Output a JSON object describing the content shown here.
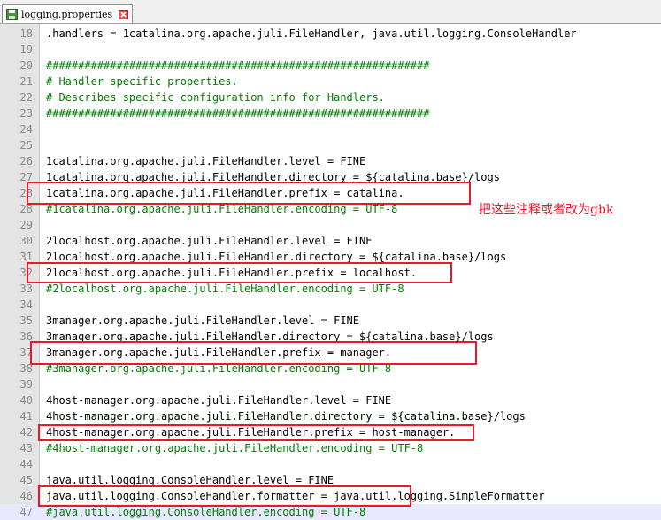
{
  "tab": {
    "label": "logging.properties",
    "icon": "save-icon",
    "close_icon": "close-icon"
  },
  "colors": {
    "comment": "#008000",
    "highlight": "#e81a2a",
    "line_number": "#8a8a8a"
  },
  "annotation": "把这些注释或者改为gbk",
  "lines": [
    {
      "num": "18",
      "text": ".handlers = 1catalina.org.apache.juli.FileHandler, java.util.logging.ConsoleHandler",
      "comment": false
    },
    {
      "num": "19",
      "text": "",
      "comment": false
    },
    {
      "num": "20",
      "text": "############################################################",
      "comment": true
    },
    {
      "num": "21",
      "text": "# Handler specific properties.",
      "comment": true
    },
    {
      "num": "22",
      "text": "# Describes specific configuration info for Handlers.",
      "comment": true
    },
    {
      "num": "23",
      "text": "############################################################",
      "comment": true
    },
    {
      "num": "24",
      "text": "",
      "comment": false
    },
    {
      "num": "25",
      "text": "",
      "comment": false
    },
    {
      "num": "26",
      "text": "1catalina.org.apache.juli.FileHandler.level = FINE",
      "comment": false
    },
    {
      "num": "27",
      "text": "1catalina.org.apache.juli.FileHandler.directory = ${catalina.base}/logs",
      "comment": false
    },
    {
      "num": "28",
      "text": "1catalina.org.apache.juli.FileHandler.prefix = catalina.",
      "comment": false
    },
    {
      "num": "28",
      "text": "#1catalina.org.apache.juli.FileHandler.encoding = UTF-8",
      "comment": true
    },
    {
      "num": "29",
      "text": "",
      "comment": false
    },
    {
      "num": "30",
      "text": "2localhost.org.apache.juli.FileHandler.level = FINE",
      "comment": false
    },
    {
      "num": "31",
      "text": "2localhost.org.apache.juli.FileHandler.directory = ${catalina.base}/logs",
      "comment": false
    },
    {
      "num": "32",
      "text": "2localhost.org.apache.juli.FileHandler.prefix = localhost.",
      "comment": false
    },
    {
      "num": "33",
      "text": "#2localhost.org.apache.juli.FileHandler.encoding = UTF-8",
      "comment": true
    },
    {
      "num": "34",
      "text": "",
      "comment": false
    },
    {
      "num": "35",
      "text": "3manager.org.apache.juli.FileHandler.level = FINE",
      "comment": false
    },
    {
      "num": "36",
      "text": "3manager.org.apache.juli.FileHandler.directory = ${catalina.base}/logs",
      "comment": false
    },
    {
      "num": "37",
      "text": "3manager.org.apache.juli.FileHandler.prefix = manager.",
      "comment": false
    },
    {
      "num": "38",
      "text": "#3manager.org.apache.juli.FileHandler.encoding = UTF-8",
      "comment": true
    },
    {
      "num": "39",
      "text": "",
      "comment": false
    },
    {
      "num": "40",
      "text": "4host-manager.org.apache.juli.FileHandler.level = FINE",
      "comment": false
    },
    {
      "num": "41",
      "text": "4host-manager.org.apache.juli.FileHandler.directory = ${catalina.base}/logs",
      "comment": false
    },
    {
      "num": "42",
      "text": "4host-manager.org.apache.juli.FileHandler.prefix = host-manager.",
      "comment": false
    },
    {
      "num": "43",
      "text": "#4host-manager.org.apache.juli.FileHandler.encoding = UTF-8",
      "comment": true
    },
    {
      "num": "44",
      "text": "",
      "comment": false
    },
    {
      "num": "45",
      "text": "java.util.logging.ConsoleHandler.level = FINE",
      "comment": false
    },
    {
      "num": "46",
      "text": "java.util.logging.ConsoleHandler.formatter = java.util.logging.SimpleFormatter",
      "comment": false
    },
    {
      "num": "47",
      "text": "#java.util.logging.ConsoleHandler.encoding = UTF-8",
      "comment": true
    }
  ]
}
